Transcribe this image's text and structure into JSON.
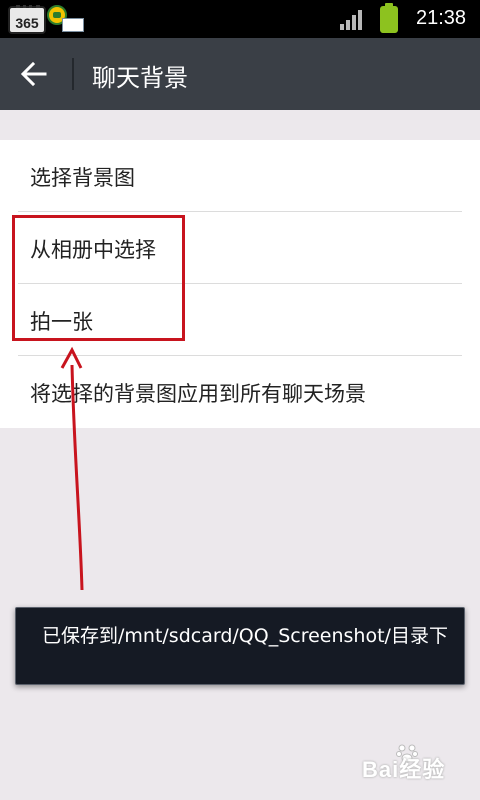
{
  "status_bar": {
    "app_badge": "365",
    "time": "21:38"
  },
  "title_bar": {
    "back_icon": "arrow-left-icon",
    "title": "聊天背景"
  },
  "options": [
    {
      "label": "选择背景图"
    },
    {
      "label": "从相册中选择"
    },
    {
      "label": "拍一张"
    },
    {
      "label": "将选择的背景图应用到所有聊天场景"
    }
  ],
  "toast": {
    "message": "已保存到/mnt/sdcard/QQ_Screenshot/目录下"
  },
  "watermark": {
    "text": "Bai经验"
  },
  "colors": {
    "title_bar": "#3a3f46",
    "highlight": "#c8141e",
    "toast_bg": "#151a24"
  }
}
